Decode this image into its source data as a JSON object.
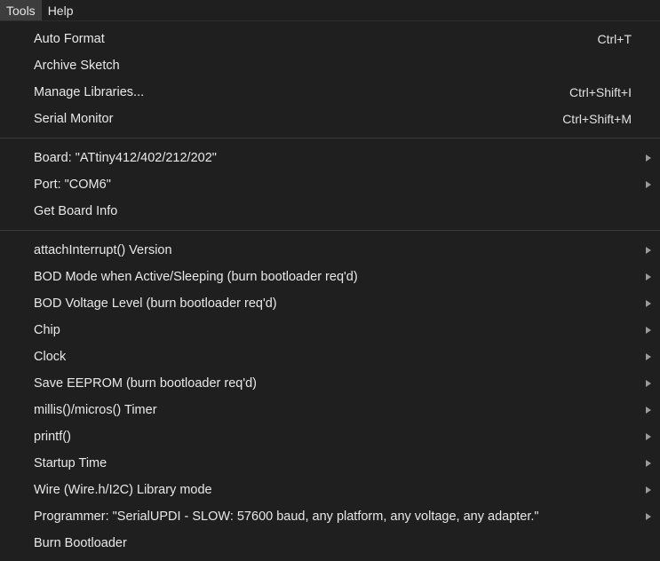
{
  "menubar": {
    "items": [
      {
        "label": "Tools"
      },
      {
        "label": "Help"
      }
    ]
  },
  "tools_menu": {
    "group1": [
      {
        "label": "Auto Format",
        "shortcut": "Ctrl+T"
      },
      {
        "label": "Archive Sketch",
        "shortcut": ""
      },
      {
        "label": "Manage Libraries...",
        "shortcut": "Ctrl+Shift+I"
      },
      {
        "label": "Serial Monitor",
        "shortcut": "Ctrl+Shift+M"
      }
    ],
    "group2": [
      {
        "label": "Board: \"ATtiny412/402/212/202\""
      },
      {
        "label": "Port: \"COM6\""
      },
      {
        "label": "Get Board Info"
      }
    ],
    "group3": [
      {
        "label": "attachInterrupt() Version"
      },
      {
        "label": "BOD Mode when Active/Sleeping (burn bootloader req'd)"
      },
      {
        "label": "BOD Voltage Level (burn bootloader req'd)"
      },
      {
        "label": "Chip"
      },
      {
        "label": "Clock"
      },
      {
        "label": "Save EEPROM (burn bootloader req'd)"
      },
      {
        "label": "millis()/micros() Timer"
      },
      {
        "label": "printf()"
      },
      {
        "label": "Startup Time"
      },
      {
        "label": "Wire (Wire.h/I2C) Library mode"
      },
      {
        "label": "Programmer: \"SerialUPDI - SLOW: 57600 baud, any platform, any voltage, any adapter.\""
      },
      {
        "label": "Burn Bootloader"
      }
    ]
  }
}
